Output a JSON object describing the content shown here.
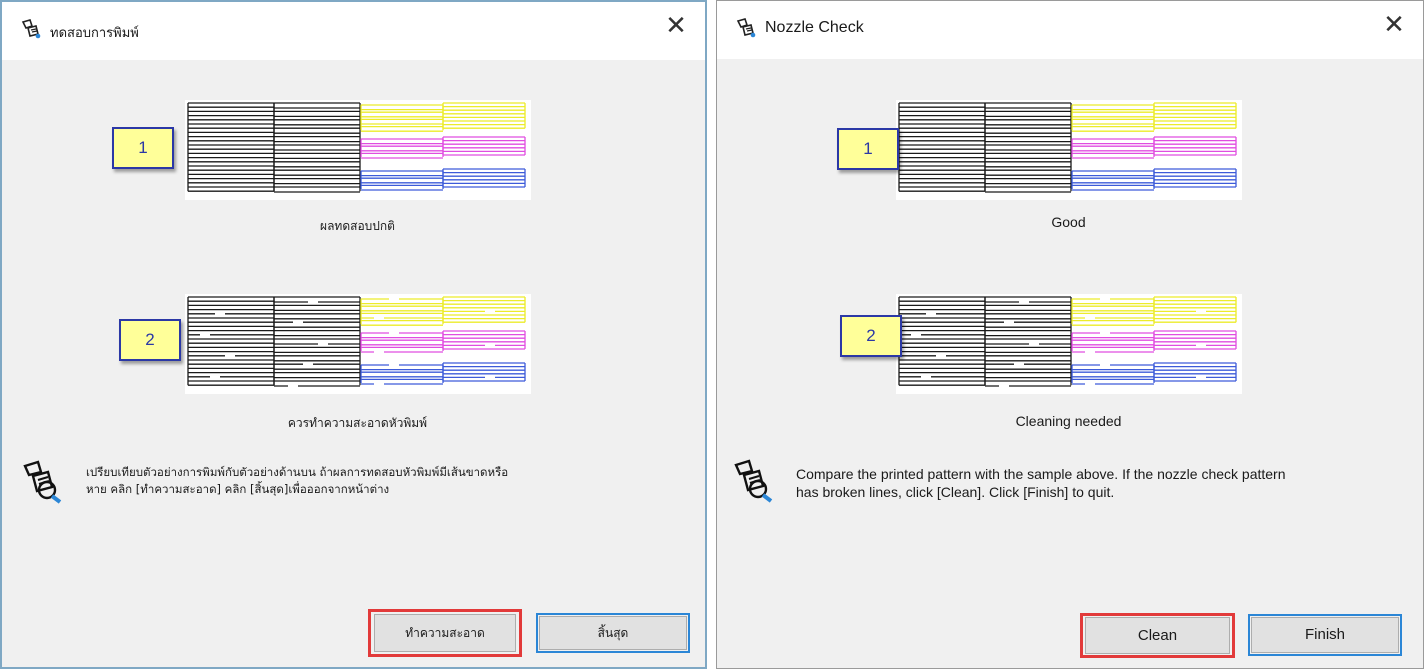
{
  "dialog_th": {
    "title": "ทดสอบการพิมพ์",
    "close_glyph": "✕",
    "sample1": {
      "number": "1",
      "caption": "ผลทดสอบปกติ"
    },
    "sample2": {
      "number": "2",
      "caption": "ควรทำความสะอาดหัวพิมพ์"
    },
    "instructions_line1": "เปรียบเทียบตัวอย่างการพิมพ์กับตัวอย่างด้านบน ถ้าผลการทดสอบหัวพิมพ์มีเส้นขาดหรือ",
    "instructions_line2": "หาย คลิก [ทำความสะอาด] คลิก [สิ้นสุด]เพื่อออกจากหน้าต่าง",
    "clean_label": "ทำความสะอาด",
    "finish_label": "สิ้นสุด"
  },
  "dialog_en": {
    "title": "Nozzle Check",
    "close_glyph": "✕",
    "sample1": {
      "number": "1",
      "caption": "Good"
    },
    "sample2": {
      "number": "2",
      "caption": "Cleaning needed"
    },
    "instructions_line1": "Compare the printed pattern with the sample above. If the nozzle check pattern",
    "instructions_line2": "has broken lines, click [Clean]. Click [Finish] to quit.",
    "clean_label": "Clean",
    "finish_label": "Finish"
  },
  "colors": {
    "black_ink": "#1a1a1a",
    "yellow_ink": "#ecec2a",
    "magenta_ink": "#e04de0",
    "cyan_ink": "#3d5bd9",
    "number_box_fill": "#ffff99",
    "number_box_border": "#2b38a6",
    "highlight_red": "#e23a3a",
    "highlight_blue": "#2b86d6"
  },
  "icons": [
    "printer-app-icon",
    "close-icon",
    "nozzle-help-icon"
  ]
}
